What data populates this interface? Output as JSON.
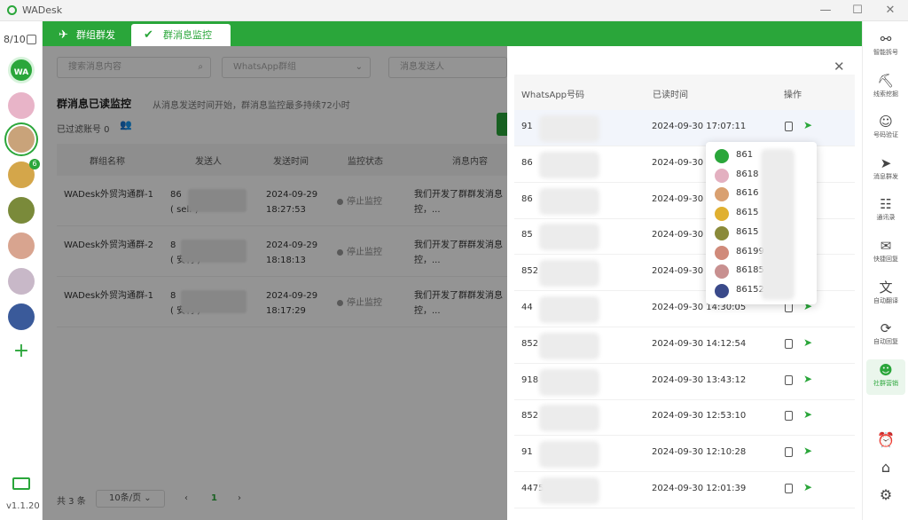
{
  "window": {
    "title": "WADesk",
    "controls": [
      "—",
      "☐",
      "✕"
    ]
  },
  "left_bar": {
    "counter": "8/10",
    "version": "v1.1.20",
    "wa_label": "WA",
    "badge": "6",
    "avatars": [
      "#e8b4c8",
      "#c9a37a",
      "#d4a64a",
      "#7a8a3a",
      "#d8a48f",
      "#c8b8c8",
      "#3a5a9a"
    ]
  },
  "top_tabs": [
    {
      "label": "群组群发",
      "icon": "send-icon"
    },
    {
      "label": "群消息监控",
      "icon": "check-icon"
    }
  ],
  "filters": {
    "search_placeholder": "搜索消息内容",
    "group_placeholder": "WhatsApp群组",
    "sender_placeholder": "消息发送人"
  },
  "section": {
    "title": "群消息已读监控",
    "desc": "从消息发送时间开始，群消息监控最多持续72小时",
    "filtered": "已过滤账号 0"
  },
  "table": {
    "headers": [
      "群组名称",
      "发送人",
      "发送时间",
      "监控状态",
      "消息内容"
    ],
    "rows": [
      {
        "group": "WADesk外贸沟通群-1",
        "sender_a": "86",
        "sender_b": "( self )",
        "date": "2024-09-29",
        "time": "18:27:53",
        "status": "停止监控",
        "msg_a": "我们开发了群群发消息",
        "msg_b": "控，..."
      },
      {
        "group": "WADesk外贸沟通群-2",
        "sender_a": "8",
        "sender_b": "( 安利 )",
        "date": "2024-09-29",
        "time": "18:18:13",
        "status": "停止监控",
        "msg_a": "我们开发了群群发消息",
        "msg_b": "控，..."
      },
      {
        "group": "WADesk外贸沟通群-1",
        "sender_a": "8",
        "sender_b": "( 安利 )",
        "date": "2024-09-29",
        "time": "18:17:29",
        "status": "停止监控",
        "msg_a": "我们开发了群群发消息",
        "msg_b": "控，..."
      }
    ]
  },
  "pager": {
    "total": "共 3 条",
    "page_size": "10条/页",
    "prev": "‹",
    "page": "1",
    "next": "›"
  },
  "panel": {
    "close": "✕",
    "headers": [
      "WhatsApp号码",
      "已读时间",
      "操作"
    ],
    "rows": [
      {
        "num": "91",
        "time": "2024-09-30 17:07:11"
      },
      {
        "num": "86",
        "time": "2024-09-30"
      },
      {
        "num": "86",
        "time": "2024-09-30"
      },
      {
        "num": "85",
        "time": "2024-09-30"
      },
      {
        "num": "852",
        "time": "2024-09-30"
      },
      {
        "num": "44",
        "time": "2024-09-30 14:30:05"
      },
      {
        "num": "852",
        "time": "2024-09-30 14:12:54"
      },
      {
        "num": "918",
        "time": "2024-09-30 13:43:12"
      },
      {
        "num": "852",
        "time": "2024-09-30 12:53:10"
      },
      {
        "num": "91",
        "time": "2024-09-30 12:10:28"
      },
      {
        "num": "4475",
        "time": "2024-09-30 12:01:39"
      }
    ]
  },
  "popup": {
    "items": [
      {
        "text": "861",
        "color": "#2aa63a"
      },
      {
        "text": "8618",
        "color": "#e3b0c0"
      },
      {
        "text": "8616",
        "color": "#d9a070"
      },
      {
        "text": "8615",
        "color": "#e0b030"
      },
      {
        "text": "8615",
        "color": "#8a8a3a"
      },
      {
        "text": "86199",
        "color": "#d08a7a"
      },
      {
        "text": "86185",
        "color": "#c89090"
      },
      {
        "text": "86152",
        "color": "#3a4a8a"
      }
    ]
  },
  "right_bar": {
    "items": [
      {
        "label": "智能拆号",
        "icon": "share-icon",
        "glyph": "⚯"
      },
      {
        "label": "线索挖掘",
        "icon": "dig-icon",
        "glyph": "⛏"
      },
      {
        "label": "号码验证",
        "icon": "verify-icon",
        "glyph": "☺"
      },
      {
        "label": "消息群发",
        "icon": "send-icon",
        "glyph": "➤"
      },
      {
        "label": "通讯录",
        "icon": "contacts-icon",
        "glyph": "☷"
      },
      {
        "label": "快捷回复",
        "icon": "quick-reply-icon",
        "glyph": "✉"
      },
      {
        "label": "自动翻译",
        "icon": "translate-icon",
        "glyph": "文"
      },
      {
        "label": "自动回复",
        "icon": "auto-reply-icon",
        "glyph": "⟳"
      },
      {
        "label": "社群营销",
        "icon": "community-icon",
        "glyph": "☻"
      }
    ],
    "bottom": [
      {
        "icon": "alarm-icon",
        "glyph": "⏰"
      },
      {
        "icon": "store-icon",
        "glyph": "⌂"
      },
      {
        "icon": "settings-icon",
        "glyph": "⚙"
      }
    ]
  },
  "colors": {
    "accent": "#2aa63a"
  }
}
